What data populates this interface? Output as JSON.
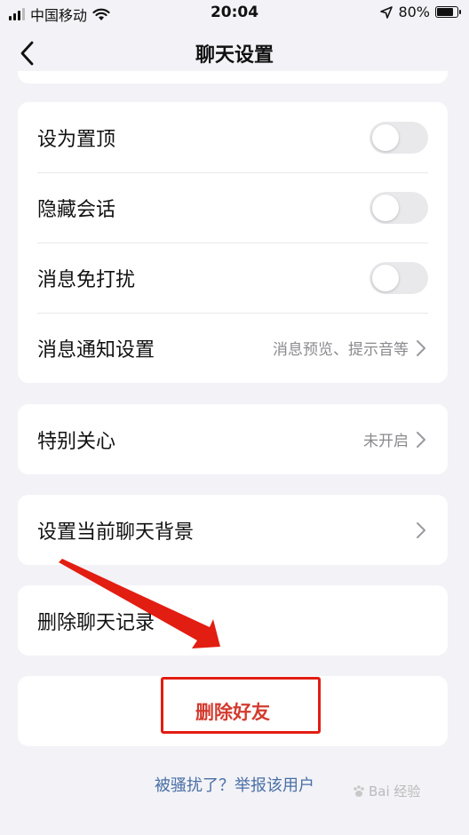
{
  "status_bar": {
    "carrier": "中国移动",
    "time": "20:04",
    "battery": "80%",
    "battery_level": 0.8
  },
  "nav": {
    "title": "聊天设置"
  },
  "settings_group": {
    "rows": [
      {
        "label": "设为置顶",
        "toggle": false
      },
      {
        "label": "隐藏会话",
        "toggle": false
      },
      {
        "label": "消息免打扰",
        "toggle": false
      },
      {
        "label": "消息通知设置",
        "value": "消息预览、提示音等"
      }
    ]
  },
  "special_care": {
    "label": "特别关心",
    "value": "未开启"
  },
  "chat_background": {
    "label": "设置当前聊天背景"
  },
  "delete_history": {
    "label": "删除聊天记录"
  },
  "delete_friend": {
    "label": "删除好友"
  },
  "report_link": {
    "label": "被骚扰了？举报该用户"
  },
  "watermark": {
    "text": "Bai 经验"
  },
  "colors": {
    "accent_red": "#d33b2f",
    "link_blue": "#4a6fa5",
    "annotation_red": "#e21d12"
  }
}
